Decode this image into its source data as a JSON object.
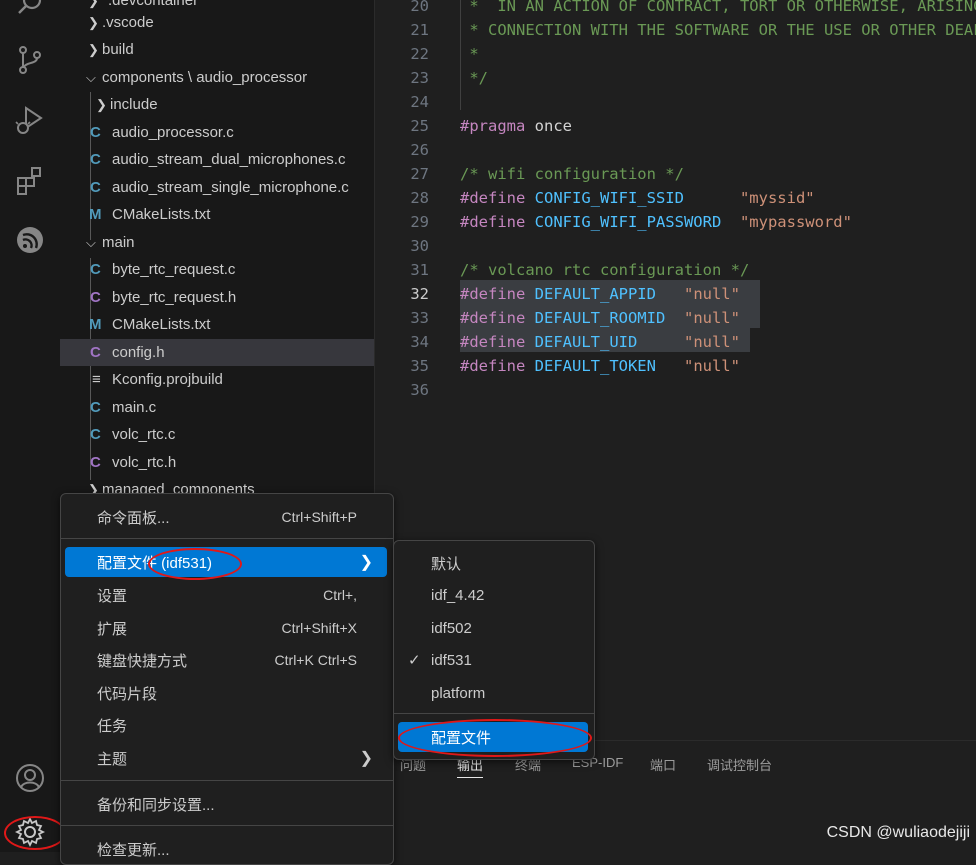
{
  "activity_bar": {
    "icons": [
      "search-icon",
      "source-control-icon",
      "run-debug-icon",
      "extensions-icon",
      "esp-idf-icon",
      "account-icon",
      "manage-gear-icon"
    ]
  },
  "explorer": {
    "items": [
      {
        "label": ".devcontainer",
        "type": "folder",
        "expanded": false
      },
      {
        "label": ".vscode",
        "type": "folder",
        "expanded": false
      },
      {
        "label": "build",
        "type": "folder",
        "expanded": false
      },
      {
        "label": "components \\ audio_processor",
        "type": "folder",
        "expanded": true
      },
      {
        "label": "include",
        "type": "folder",
        "expanded": false
      },
      {
        "label": "audio_processor.c",
        "type": "c"
      },
      {
        "label": "audio_stream_dual_microphones.c",
        "type": "c"
      },
      {
        "label": "audio_stream_single_microphone.c",
        "type": "c"
      },
      {
        "label": "CMakeLists.txt",
        "type": "m"
      },
      {
        "label": "main",
        "type": "folder",
        "expanded": true
      },
      {
        "label": "byte_rtc_request.c",
        "type": "c"
      },
      {
        "label": "byte_rtc_request.h",
        "type": "h"
      },
      {
        "label": "CMakeLists.txt",
        "type": "m"
      },
      {
        "label": "config.h",
        "type": "h"
      },
      {
        "label": "Kconfig.projbuild",
        "type": "k"
      },
      {
        "label": "main.c",
        "type": "c"
      },
      {
        "label": "volc_rtc.c",
        "type": "c"
      },
      {
        "label": "volc_rtc.h",
        "type": "h"
      },
      {
        "label": "managed_components",
        "type": "folder",
        "expanded": false
      }
    ]
  },
  "editor": {
    "lines": [
      {
        "n": "20",
        "code": " *  IN AN ACTION OF CONTRACT, TORT OR OTHERWISE, ARISING"
      },
      {
        "n": "21",
        "code": " * CONNECTION WITH THE SOFTWARE OR THE USE OR OTHER DEALINGS"
      },
      {
        "n": "22",
        "code": " *"
      },
      {
        "n": "23",
        "code": " */"
      },
      {
        "n": "24",
        "code": ""
      },
      {
        "n": "25",
        "kw": "#pragma",
        "rest": " once"
      },
      {
        "n": "26",
        "code": ""
      },
      {
        "n": "27",
        "comment": "/* wifi configuration */"
      },
      {
        "n": "28",
        "kw": "#define",
        "id": " CONFIG_WIFI_SSID",
        "pad": "      ",
        "str": "\"myssid\""
      },
      {
        "n": "29",
        "kw": "#define",
        "id": " CONFIG_WIFI_PASSWORD",
        "pad": "  ",
        "str": "\"mypassword\""
      },
      {
        "n": "30",
        "code": ""
      },
      {
        "n": "31",
        "comment": "/* volcano rtc configuration */"
      },
      {
        "n": "32",
        "kw": "#define",
        "id": " DEFAULT_APPID",
        "pad": "   ",
        "str": "\"null\""
      },
      {
        "n": "33",
        "kw": "#define",
        "id": " DEFAULT_ROOMID",
        "pad": "  ",
        "str": "\"null\""
      },
      {
        "n": "34",
        "kw": "#define",
        "id": " DEFAULT_UID",
        "pad": "     ",
        "str": "\"null\""
      },
      {
        "n": "35",
        "kw": "#define",
        "id": " DEFAULT_TOKEN",
        "pad": "   ",
        "str": "\"null\""
      },
      {
        "n": "36",
        "code": ""
      }
    ],
    "active_line": "32"
  },
  "panel": {
    "tabs": [
      "问题",
      "输出",
      "终端",
      "ESP-IDF",
      "端口",
      "调试控制台"
    ],
    "active_tab": "输出"
  },
  "manage_menu": {
    "items": [
      {
        "label": "命令面板...",
        "shortcut": "Ctrl+Shift+P"
      },
      {
        "label": "配置文件 (idf531)",
        "submenu": true,
        "highlighted": true
      },
      {
        "label": "设置",
        "shortcut": "Ctrl+,"
      },
      {
        "label": "扩展",
        "shortcut": "Ctrl+Shift+X"
      },
      {
        "label": "键盘快捷方式",
        "shortcut": "Ctrl+K Ctrl+S"
      },
      {
        "label": "代码片段",
        "shortcut": ""
      },
      {
        "label": "任务",
        "shortcut": ""
      },
      {
        "label": "主题",
        "submenu": true
      },
      {
        "label": "备份和同步设置...",
        "shortcut": ""
      },
      {
        "label": "检查更新...",
        "shortcut": ""
      }
    ]
  },
  "profiles_submenu": {
    "items": [
      {
        "label": "默认",
        "checked": false
      },
      {
        "label": "idf_4.42",
        "checked": false
      },
      {
        "label": "idf502",
        "checked": false
      },
      {
        "label": "idf531",
        "checked": true
      },
      {
        "label": "platform",
        "checked": false
      }
    ],
    "action": "配置文件",
    "check_mark": "✓"
  },
  "watermark": "CSDN @wuliaodejiji",
  "colors": {
    "accent": "#0078d4",
    "annotation": "#e01818"
  }
}
